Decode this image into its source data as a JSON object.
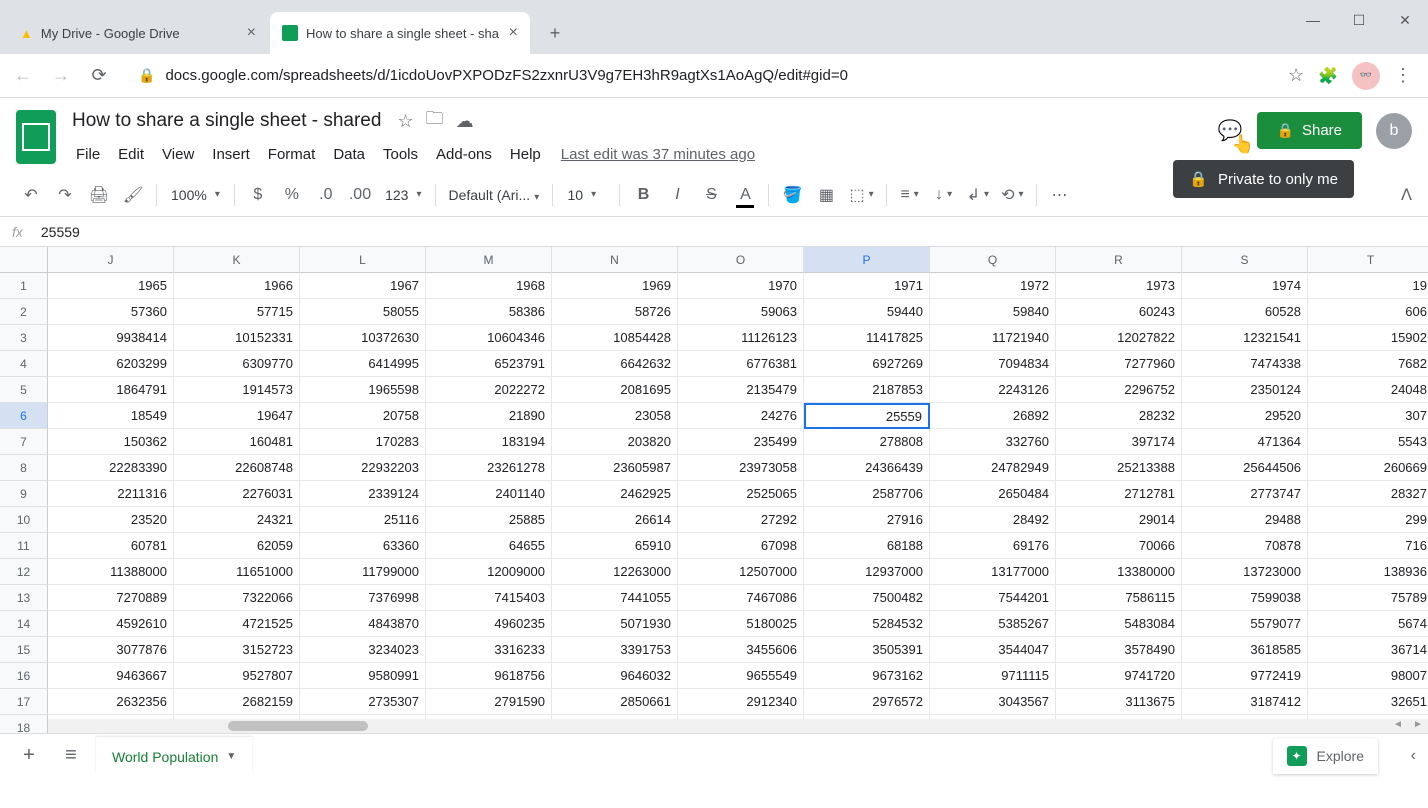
{
  "browser": {
    "tabs": [
      {
        "title": "My Drive - Google Drive",
        "favicon": "drive"
      },
      {
        "title": "How to share a single sheet - sha",
        "favicon": "sheets"
      }
    ],
    "url": "docs.google.com/spreadsheets/d/1icdoUovPXPODzFS2zxnrU3V9g7EH3hR9agtXs1AoAgQ/edit#gid=0"
  },
  "doc": {
    "title": "How to share a single sheet - shared",
    "last_edit": "Last edit was 37 minutes ago",
    "share_label": "Share",
    "tooltip": "Private to only me",
    "user_initial": "b"
  },
  "menu": [
    "File",
    "Edit",
    "View",
    "Insert",
    "Format",
    "Data",
    "Tools",
    "Add-ons",
    "Help"
  ],
  "toolbar": {
    "zoom": "100%",
    "number_format": "123",
    "font": "Default (Ari...",
    "font_size": "10"
  },
  "formula": {
    "fx": "fx",
    "value": "25559"
  },
  "columns": [
    "J",
    "K",
    "L",
    "M",
    "N",
    "O",
    "P",
    "Q",
    "R",
    "S",
    "T"
  ],
  "active_cell": {
    "row": 6,
    "col": "P"
  },
  "rows": [
    {
      "n": 1,
      "cells": [
        "1965",
        "1966",
        "1967",
        "1968",
        "1969",
        "1970",
        "1971",
        "1972",
        "1973",
        "1974",
        "19"
      ]
    },
    {
      "n": 2,
      "cells": [
        "57360",
        "57715",
        "58055",
        "58386",
        "58726",
        "59063",
        "59440",
        "59840",
        "60243",
        "60528",
        "606"
      ]
    },
    {
      "n": 3,
      "cells": [
        "9938414",
        "10152331",
        "10372630",
        "10604346",
        "10854428",
        "11126123",
        "11417825",
        "11721940",
        "12027822",
        "12321541",
        "15902"
      ]
    },
    {
      "n": 4,
      "cells": [
        "6203299",
        "6309770",
        "6414995",
        "6523791",
        "6642632",
        "6776381",
        "6927269",
        "7094834",
        "7277960",
        "7474338",
        "7682"
      ]
    },
    {
      "n": 5,
      "cells": [
        "1864791",
        "1914573",
        "1965598",
        "2022272",
        "2081695",
        "2135479",
        "2187853",
        "2243126",
        "2296752",
        "2350124",
        "24048"
      ]
    },
    {
      "n": 6,
      "cells": [
        "18549",
        "19647",
        "20758",
        "21890",
        "23058",
        "24276",
        "25559",
        "26892",
        "28232",
        "29520",
        "307"
      ]
    },
    {
      "n": 7,
      "cells": [
        "150362",
        "160481",
        "170283",
        "183194",
        "203820",
        "235499",
        "278808",
        "332760",
        "397174",
        "471364",
        "5543"
      ]
    },
    {
      "n": 8,
      "cells": [
        "22283390",
        "22608748",
        "22932203",
        "23261278",
        "23605987",
        "23973058",
        "24366439",
        "24782949",
        "25213388",
        "25644506",
        "260669"
      ]
    },
    {
      "n": 9,
      "cells": [
        "2211316",
        "2276031",
        "2339124",
        "2401140",
        "2462925",
        "2525065",
        "2587706",
        "2650484",
        "2712781",
        "2773747",
        "28327"
      ]
    },
    {
      "n": 10,
      "cells": [
        "23520",
        "24321",
        "25116",
        "25885",
        "26614",
        "27292",
        "27916",
        "28492",
        "29014",
        "29488",
        "299"
      ]
    },
    {
      "n": 11,
      "cells": [
        "60781",
        "62059",
        "63360",
        "64655",
        "65910",
        "67098",
        "68188",
        "69176",
        "70066",
        "70878",
        "716"
      ]
    },
    {
      "n": 12,
      "cells": [
        "11388000",
        "11651000",
        "11799000",
        "12009000",
        "12263000",
        "12507000",
        "12937000",
        "13177000",
        "13380000",
        "13723000",
        "138936"
      ]
    },
    {
      "n": 13,
      "cells": [
        "7270889",
        "7322066",
        "7376998",
        "7415403",
        "7441055",
        "7467086",
        "7500482",
        "7544201",
        "7586115",
        "7599038",
        "75789"
      ]
    },
    {
      "n": 14,
      "cells": [
        "4592610",
        "4721525",
        "4843870",
        "4960235",
        "5071930",
        "5180025",
        "5284532",
        "5385267",
        "5483084",
        "5579077",
        "5674"
      ]
    },
    {
      "n": 15,
      "cells": [
        "3077876",
        "3152723",
        "3234023",
        "3316233",
        "3391753",
        "3455606",
        "3505391",
        "3544047",
        "3578490",
        "3618585",
        "36714"
      ]
    },
    {
      "n": 16,
      "cells": [
        "9463667",
        "9527807",
        "9580991",
        "9618756",
        "9646032",
        "9655549",
        "9673162",
        "9711115",
        "9741720",
        "9772419",
        "98007"
      ]
    },
    {
      "n": 17,
      "cells": [
        "2632356",
        "2682159",
        "2735307",
        "2791590",
        "2850661",
        "2912340",
        "2976572",
        "3043567",
        "3113675",
        "3187412",
        "32651"
      ]
    },
    {
      "n": 18,
      "cells": [
        "",
        "",
        "",
        "",
        "",
        "",
        "",
        "",
        "",
        "",
        ""
      ]
    }
  ],
  "sheet_tab": "World Population",
  "explore": "Explore"
}
